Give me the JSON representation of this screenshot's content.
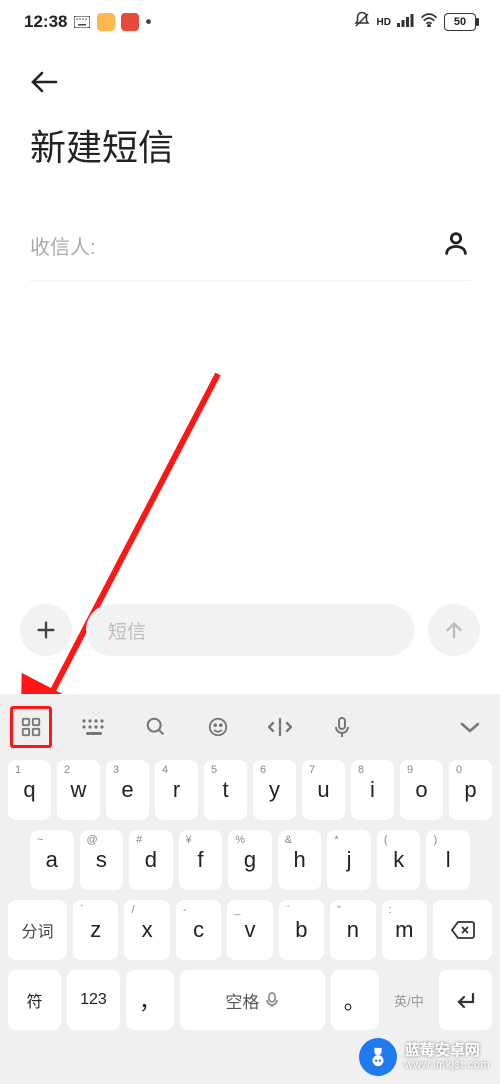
{
  "status": {
    "time": "12:38",
    "battery": "50"
  },
  "header": {
    "title": "新建短信"
  },
  "recipient": {
    "label": "收信人:"
  },
  "compose": {
    "placeholder": "短信"
  },
  "keyboard": {
    "row1": [
      {
        "sup": "1",
        "main": "q"
      },
      {
        "sup": "2",
        "main": "w"
      },
      {
        "sup": "3",
        "main": "e"
      },
      {
        "sup": "4",
        "main": "r"
      },
      {
        "sup": "5",
        "main": "t"
      },
      {
        "sup": "6",
        "main": "y"
      },
      {
        "sup": "7",
        "main": "u"
      },
      {
        "sup": "8",
        "main": "i"
      },
      {
        "sup": "9",
        "main": "o"
      },
      {
        "sup": "0",
        "main": "p"
      }
    ],
    "row2": [
      {
        "sup": "~",
        "main": "a"
      },
      {
        "sup": "@",
        "main": "s"
      },
      {
        "sup": "#",
        "main": "d"
      },
      {
        "sup": "¥",
        "main": "f"
      },
      {
        "sup": "%",
        "main": "g"
      },
      {
        "sup": "&",
        "main": "h"
      },
      {
        "sup": "*",
        "main": "j"
      },
      {
        "sup": "(",
        "main": "k"
      },
      {
        "sup": ")",
        "main": "l"
      }
    ],
    "row3": [
      {
        "sup": "`",
        "main": "z"
      },
      {
        "sup": "/",
        "main": "x"
      },
      {
        "sup": "-",
        "main": "c"
      },
      {
        "sup": "_",
        "main": "v"
      },
      {
        "sup": "¨",
        "main": "b"
      },
      {
        "sup": "\"",
        "main": "n"
      },
      {
        "sup": ":",
        "main": "m"
      }
    ],
    "fenci": "分词",
    "fu": "符",
    "num": "123",
    "comma": "，",
    "space": "空格",
    "period": "。",
    "lang": "英/中",
    "enter_icon": "↵"
  },
  "watermark": {
    "title": "蓝莓安卓网",
    "url": "www.lmkjst.com"
  }
}
